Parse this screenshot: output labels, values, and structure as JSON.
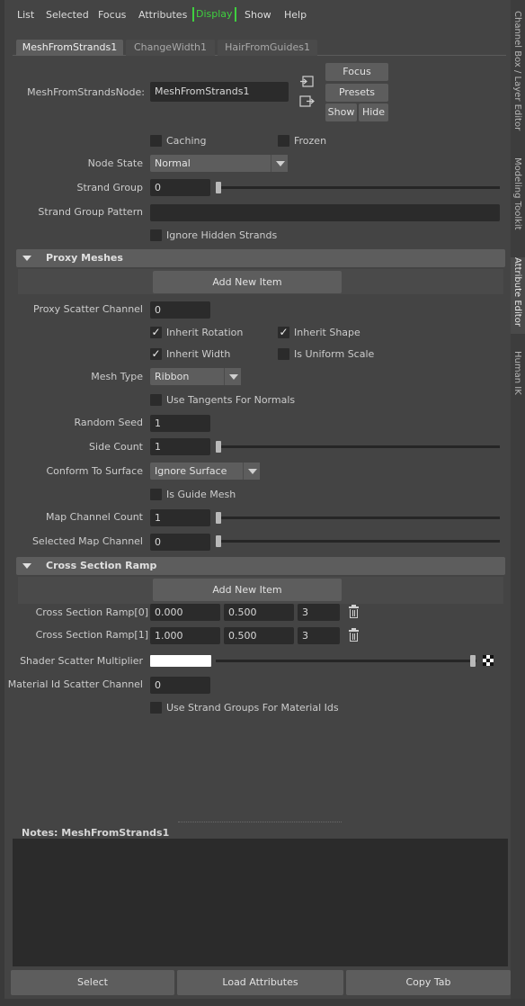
{
  "menu": {
    "items": [
      "List",
      "Selected",
      "Focus",
      "Attributes",
      "Display",
      "Show",
      "Help"
    ]
  },
  "tabs": [
    "MeshFromStrands1",
    "ChangeWidth1",
    "HairFromGuides1"
  ],
  "side_tabs": [
    "Channel Box / Layer Editor",
    "Modeling Toolkit",
    "Attribute Editor",
    "Human IK"
  ],
  "node": {
    "label": "MeshFromStrandsNode:",
    "value": "MeshFromStrands1",
    "focus_label": "Focus",
    "presets_label": "Presets",
    "show_label": "Show",
    "hide_label": "Hide"
  },
  "general": {
    "caching_label": "Caching",
    "frozen_label": "Frozen",
    "node_state_label": "Node State",
    "node_state_value": "Normal",
    "strand_group_label": "Strand Group",
    "strand_group_value": "0",
    "strand_group_pattern_label": "Strand Group Pattern",
    "strand_group_pattern_value": "",
    "ignore_hidden_label": "Ignore Hidden Strands"
  },
  "proxy": {
    "title": "Proxy Meshes",
    "add_new_item_label": "Add New Item",
    "scatter_channel_label": "Proxy Scatter Channel",
    "scatter_channel_value": "0",
    "inherit_rotation_label": "Inherit Rotation",
    "inherit_shape_label": "Inherit Shape",
    "inherit_width_label": "Inherit Width",
    "uniform_scale_label": "Is Uniform Scale",
    "mesh_type_label": "Mesh Type",
    "mesh_type_value": "Ribbon",
    "use_tangents_label": "Use Tangents For Normals",
    "random_seed_label": "Random Seed",
    "random_seed_value": "1",
    "side_count_label": "Side Count",
    "side_count_value": "1",
    "conform_label": "Conform To Surface",
    "conform_value": "Ignore Surface",
    "guide_mesh_label": "Is Guide Mesh",
    "map_channel_count_label": "Map Channel Count",
    "map_channel_count_value": "1",
    "selected_map_channel_label": "Selected Map Channel",
    "selected_map_channel_value": "0"
  },
  "ramp": {
    "title": "Cross Section Ramp",
    "add_new_item_label": "Add New Item",
    "rows": [
      {
        "label": "Cross Section Ramp[0]",
        "v1": "0.000",
        "v2": "0.500",
        "v3": "3"
      },
      {
        "label": "Cross Section Ramp[1]",
        "v1": "1.000",
        "v2": "0.500",
        "v3": "3"
      }
    ]
  },
  "shader": {
    "scatter_label": "Shader Scatter Multiplier",
    "material_label": "Material Id Scatter Channel",
    "material_value": "0",
    "strand_groups_label": "Use Strand Groups For Material Ids"
  },
  "notes": {
    "label": "Notes:  MeshFromStrands1"
  },
  "bottom": {
    "select_label": "Select",
    "load_label": "Load Attributes",
    "copy_label": "Copy Tab"
  },
  "colors": {
    "display_highlight": "#3fd03f",
    "panel": "#444444",
    "field": "#2b2b2b",
    "button": "#5d5d5d"
  }
}
